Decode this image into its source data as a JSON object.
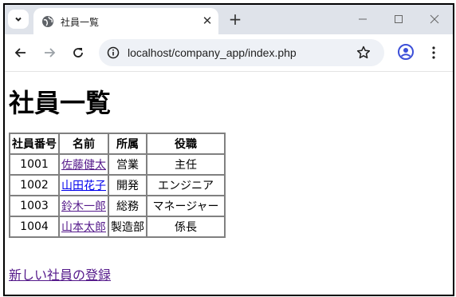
{
  "browser": {
    "tab_title": "社員一覧",
    "url": "localhost/company_app/index.php",
    "icons": {
      "tab_menu": "chevron-down-icon",
      "favicon": "globe-icon",
      "close": "close-icon",
      "new_tab": "plus-icon",
      "minimize": "minimize-icon",
      "maximize": "maximize-icon",
      "window_close": "window-close-icon",
      "back": "back-arrow-icon",
      "forward": "forward-arrow-icon",
      "reload": "reload-icon",
      "site_info": "info-icon",
      "bookmark": "star-icon",
      "profile": "profile-icon",
      "menu": "kebab-menu-icon"
    }
  },
  "page": {
    "heading": "社員一覧",
    "table": {
      "headers": [
        "社員番号",
        "名前",
        "所属",
        "役職"
      ],
      "rows": [
        {
          "id": "1001",
          "name": "佐藤健太",
          "dept": "営業",
          "role": "主任",
          "visited": true
        },
        {
          "id": "1002",
          "name": "山田花子",
          "dept": "開発",
          "role": "エンジニア",
          "visited": false
        },
        {
          "id": "1003",
          "name": "鈴木一郎",
          "dept": "総務",
          "role": "マネージャー",
          "visited": true
        },
        {
          "id": "1004",
          "name": "山本太郎",
          "dept": "製造部",
          "role": "係長",
          "visited": true
        }
      ]
    },
    "register_link": "新しい社員の登録"
  },
  "colors": {
    "visited_link": "#551a8b",
    "unvisited_link": "#0000ee",
    "tab_strip": "#dfe3ea",
    "omnibox": "#eef1f6"
  }
}
